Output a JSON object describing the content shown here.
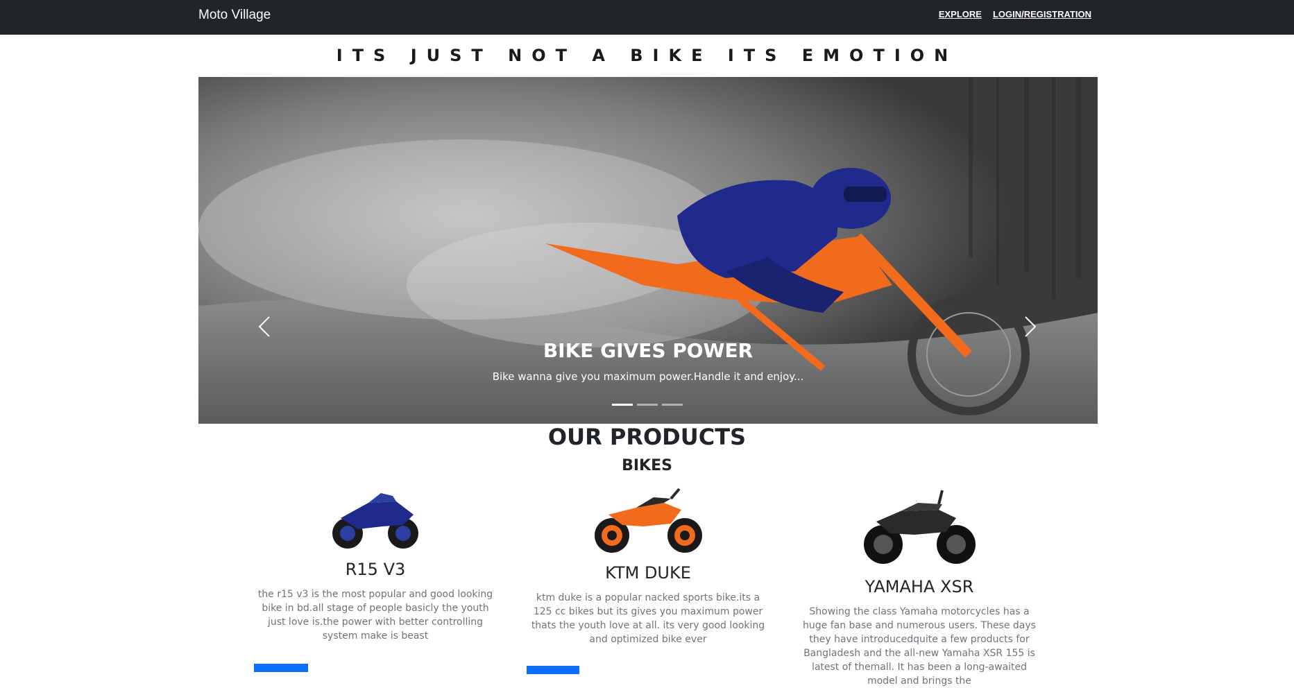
{
  "navbar": {
    "brand": "Moto Village",
    "links": [
      "EXPLORE",
      "LOGIN/REGISTRATION"
    ]
  },
  "hero": {
    "tagline": "ITS JUST NOT A BIKE ITS EMOTION",
    "slide": {
      "title": "BIKE GIVES POWER",
      "text": "Bike wanna give you maximum power.Handle it and enjoy..."
    },
    "indicators_total": 3,
    "indicators_active": 1
  },
  "products": {
    "title": "OUR PRODUCTS",
    "subtitle": "BIKES",
    "items": [
      {
        "name": "R15 V3",
        "description": "the r15 v3 is the most popular and good looking bike in bd.all stage of people basicly the youth just love is.the power with better controlling system make is beast"
      },
      {
        "name": "KTM DUKE",
        "description": "ktm duke is a popular nacked sports bike.its a 125 cc bikes but its gives you maximum power thats the youth love at all. its very good looking and optimized bike ever"
      },
      {
        "name": "YAMAHA XSR",
        "description": "Showing the class Yamaha motorcycles has a huge fan base and numerous users. These days they have introducedquite a few products for Bangladesh and the all-new Yamaha XSR 155 is latest of themall. It has been a long-awaited model and brings the"
      }
    ]
  },
  "colors": {
    "navbar_bg": "#212529",
    "accent_button": "#0d6efd",
    "bike_blue": "#1f2a8c",
    "bike_orange": "#f26a1b",
    "bike_black": "#2a2a2a"
  }
}
